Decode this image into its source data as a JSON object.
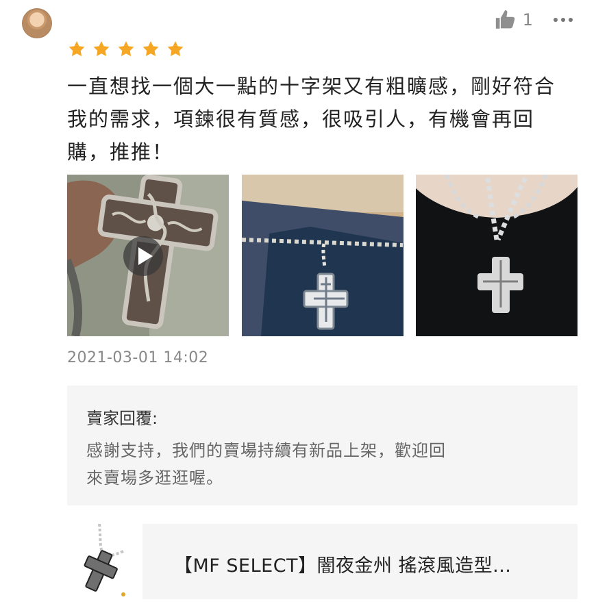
{
  "header": {
    "like_count": "1"
  },
  "review": {
    "rating": 5,
    "star_color": "#f5a623",
    "text_lines": [
      "一直想找一個大一點的十字架又有粗曠感，剛好符合",
      "我的需求，項鍊很有質感，很吸引人，有機會再回",
      "購，推推！"
    ],
    "timestamp": "2021-03-01 14:02"
  },
  "seller_reply": {
    "title": "賣家回覆:",
    "lines": [
      "感謝支持，我們的賣場持續有新品上架，歡迎回",
      "來賣場多逛逛喔。"
    ]
  },
  "product": {
    "name": "【MF SELECT】闇夜金州 搖滾風造型..."
  },
  "icons": {
    "like": "thumbs-up-icon",
    "more": "more-dots-icon",
    "play": "play-icon"
  }
}
